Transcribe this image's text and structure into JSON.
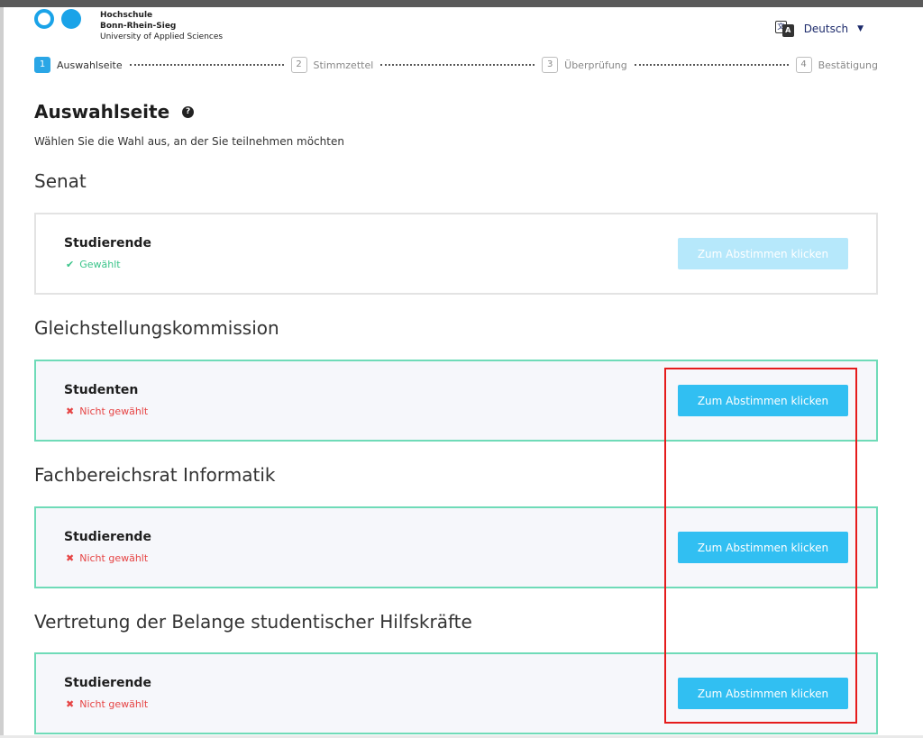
{
  "header": {
    "logo_line1": "Hochschule",
    "logo_line2": "Bonn-Rhein-Sieg",
    "logo_line3": "University of Applied Sciences",
    "language": "Deutsch",
    "lang_icon_a": "文",
    "lang_icon_b": "A"
  },
  "steps": [
    {
      "num": "1",
      "label": "Auswahlseite"
    },
    {
      "num": "2",
      "label": "Stimmzettel"
    },
    {
      "num": "3",
      "label": "Überprüfung"
    },
    {
      "num": "4",
      "label": "Bestätigung"
    }
  ],
  "page": {
    "title": "Auswahlseite",
    "help_glyph": "?",
    "subtitle": "Wählen Sie die Wahl aus, an der Sie teilnehmen möchten"
  },
  "elections": [
    {
      "section": "Senat",
      "group": "Studierende",
      "status": "Gewählt",
      "status_mark": "✔",
      "button": "Zum Abstimmen klicken"
    },
    {
      "section": "Gleichstellungskommission",
      "group": "Studenten",
      "status": "Nicht gewählt",
      "status_mark": "✖",
      "button": "Zum Abstimmen klicken"
    },
    {
      "section": "Fachbereichsrat Informatik",
      "group": "Studierende",
      "status": "Nicht gewählt",
      "status_mark": "✖",
      "button": "Zum Abstimmen klicken"
    },
    {
      "section": "Vertretung der Belange studentischer Hilfskräfte",
      "group": "Studierende",
      "status": "Nicht gewählt",
      "status_mark": "✖",
      "button": "Zum Abstimmen klicken"
    }
  ],
  "colors": {
    "accent": "#31bff2",
    "success": "#3bc48a",
    "error": "#e64545",
    "card_border": "#6fdbb8",
    "highlight": "#e51c1c"
  }
}
